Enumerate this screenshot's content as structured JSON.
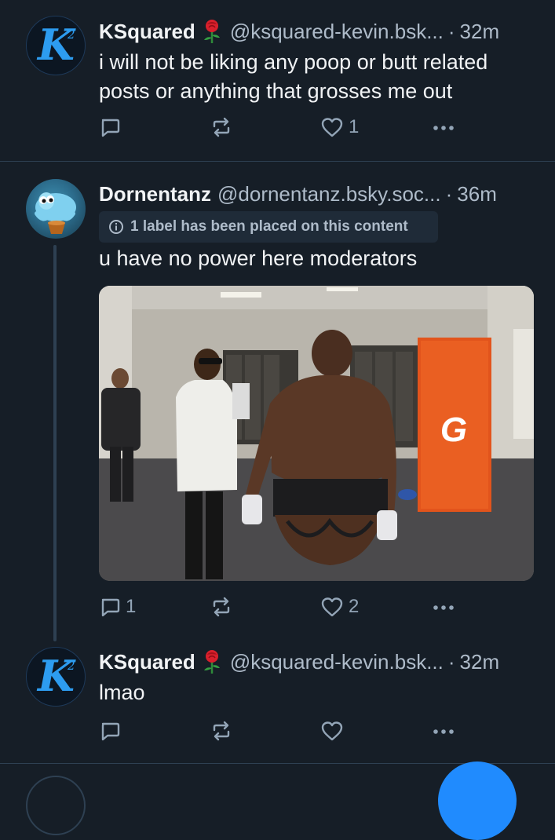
{
  "posts": [
    {
      "display_name": "KSquared",
      "handle": "@ksquared-kevin.bsk...",
      "separator": "·",
      "time": "32m",
      "text": "i will not be liking any poop or butt related posts or anything that grosses me out",
      "reply_count": "",
      "repost_count": "",
      "like_count": "1"
    },
    {
      "display_name": "Dornentanz",
      "handle": "@dornentanz.bsky.soc...",
      "separator": "·",
      "time": "36m",
      "label_notice": "1 label has been placed on this content",
      "text": "u have no power here moderators",
      "media_logo": "G",
      "reply_count": "1",
      "repost_count": "",
      "like_count": "2"
    },
    {
      "display_name": "KSquared",
      "handle": "@ksquared-kevin.bsk...",
      "separator": "·",
      "time": "32m",
      "text": "lmao",
      "reply_count": "",
      "repost_count": "",
      "like_count": ""
    }
  ],
  "avatar": {
    "k_letter": "K",
    "k_sup": "2"
  },
  "colors": {
    "background": "#161e27",
    "divider": "#2e4052",
    "muted_text": "#aebbc9",
    "icon": "#93a5b7",
    "accent": "#208bfe",
    "k_logo": "#2d9cf0"
  },
  "icons": {
    "reply": "speech-bubble-icon",
    "repost": "repost-arrows-icon",
    "like": "heart-icon",
    "more": "ellipsis-icon",
    "label": "info-circle-icon",
    "decoration": "rose-emoji"
  }
}
